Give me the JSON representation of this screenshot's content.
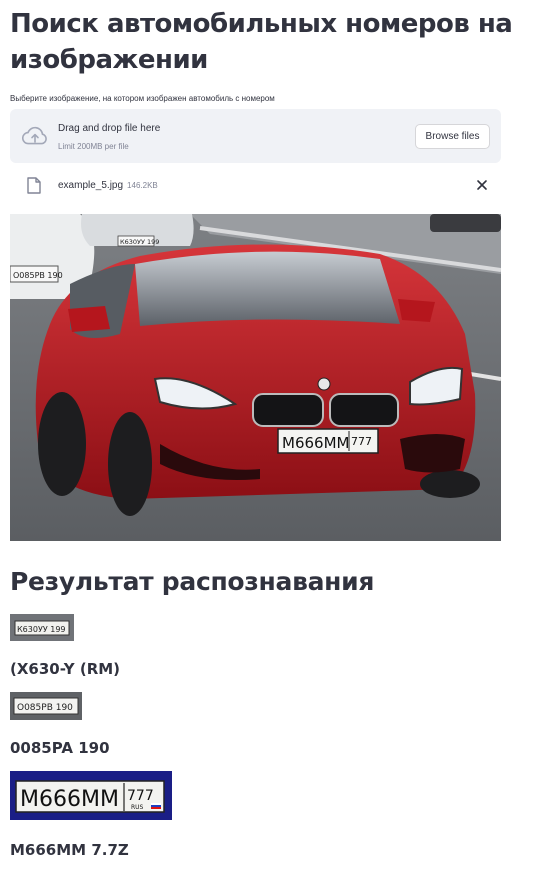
{
  "page": {
    "title": "Поиск автомобильных номеров на изображении"
  },
  "uploader": {
    "label": "Выберите изображение, на котором изображен автомобиль с номером",
    "dropzone_text": "Drag and drop file here",
    "limit_text": "Limit 200MB per file",
    "browse_label": "Browse files",
    "icon": "cloud-upload-icon"
  },
  "uploaded_file": {
    "name": "example_5.jpg",
    "size": "146.2KB",
    "icon": "file-icon",
    "remove_icon": "close-icon"
  },
  "main_image": {
    "plates_visible": [
      "К630УУ 199",
      "О085РВ 190",
      "М666ММ 777"
    ]
  },
  "results": {
    "heading": "Результат распознавания",
    "items": [
      {
        "crop_plate": "К630УУ 199",
        "text": "(X630-Y (RM)"
      },
      {
        "crop_plate": "О085РВ 190",
        "text": "0085PA 190"
      },
      {
        "crop_plate": "М666ММ 777",
        "text": "M666MM 7.7Z"
      }
    ]
  },
  "colors": {
    "text": "#31333f",
    "dropzone_bg": "#f0f2f6",
    "muted": "#808495",
    "car_red": "#c0141c"
  }
}
